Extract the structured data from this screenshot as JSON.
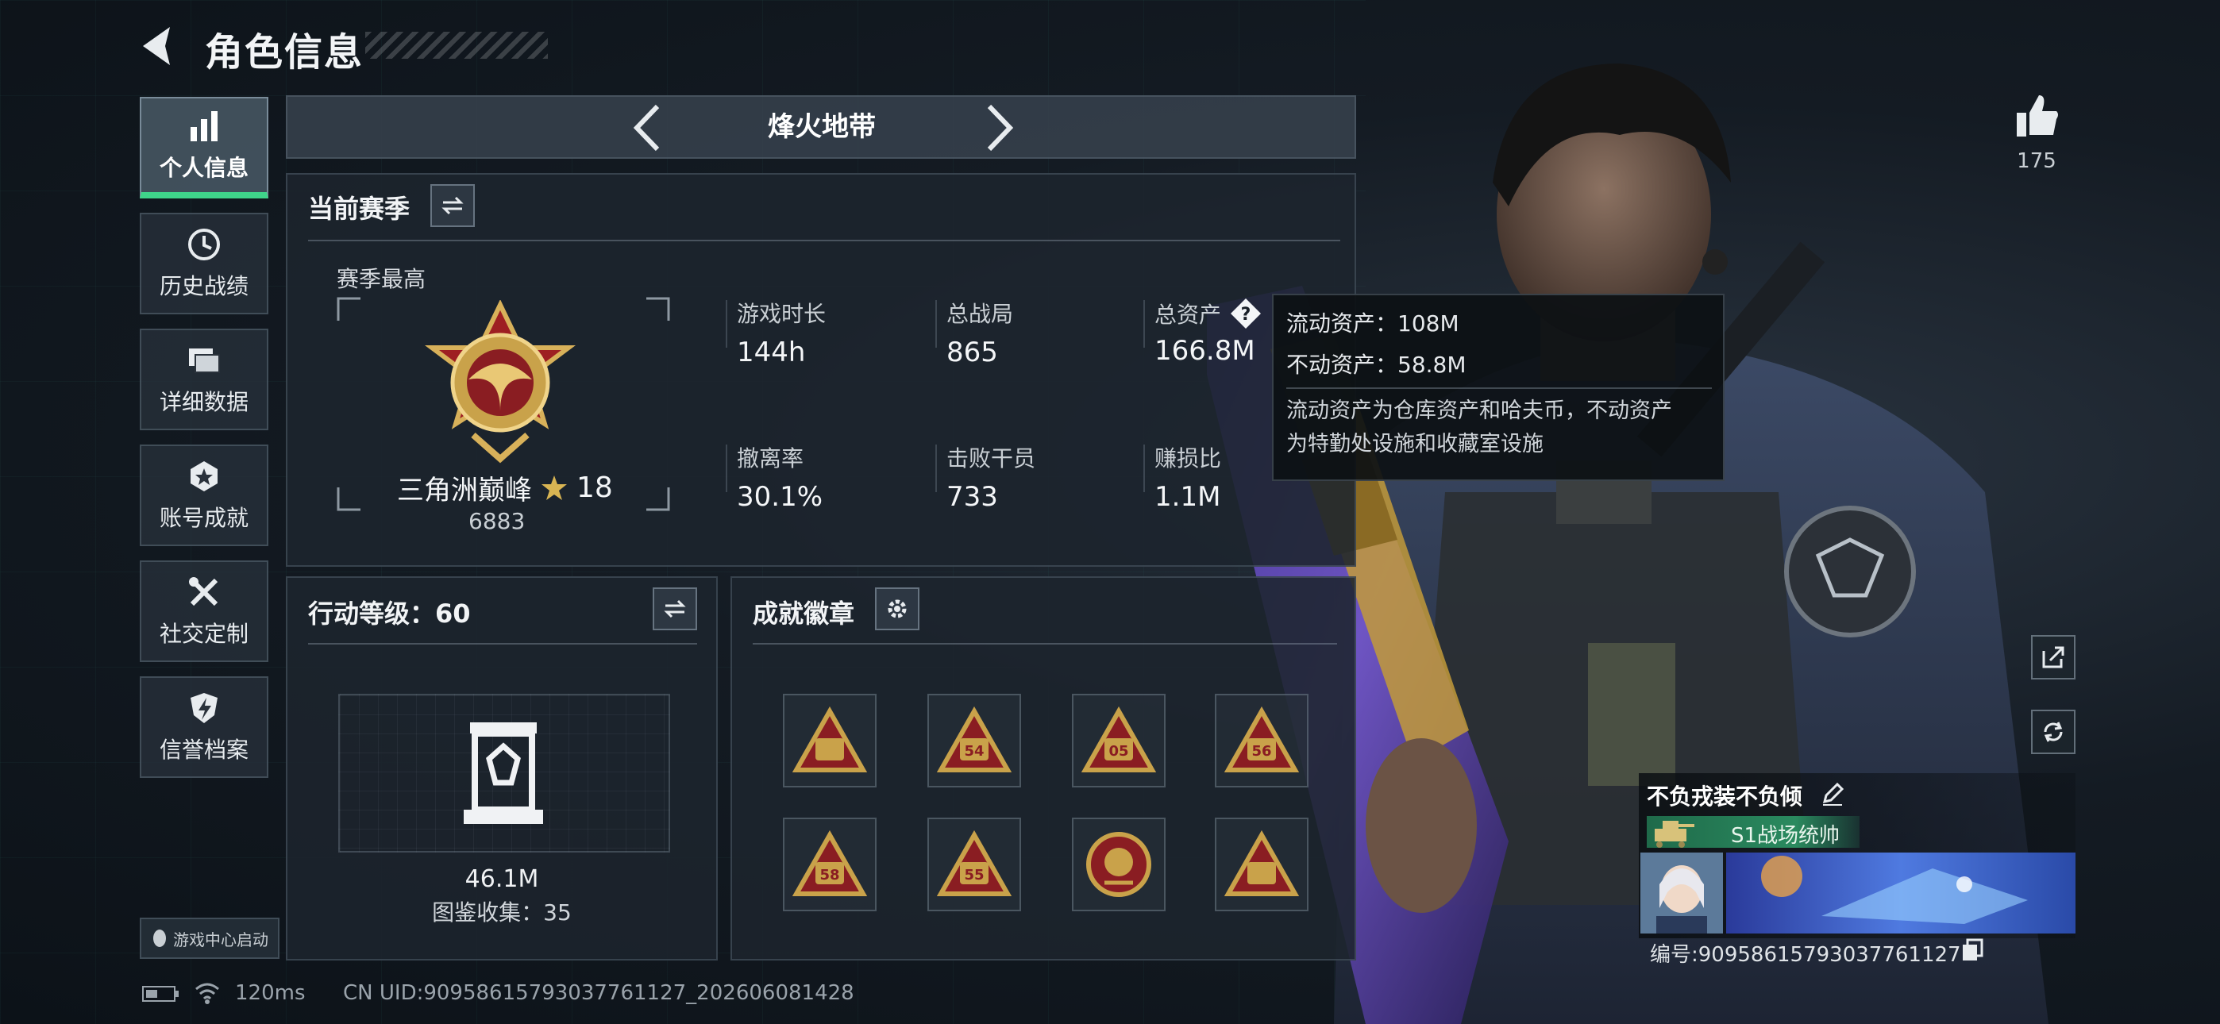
{
  "header": {
    "title": "角色信息"
  },
  "sidebar": {
    "items": [
      {
        "label": "个人信息",
        "icon": "bar-chart-icon",
        "active": true
      },
      {
        "label": "历史战绩",
        "icon": "history-clock-icon"
      },
      {
        "label": "详细数据",
        "icon": "folder-stack-icon"
      },
      {
        "label": "账号成就",
        "icon": "medal-star-icon"
      },
      {
        "label": "社交定制",
        "icon": "tools-cross-icon"
      },
      {
        "label": "信誉档案",
        "icon": "shield-bolt-icon"
      }
    ],
    "launch_label": "游戏中心启动"
  },
  "mode": {
    "label": "烽火地带"
  },
  "season": {
    "title": "当前赛季",
    "peak_label": "赛季最高",
    "rank_name": "三角洲巅峰",
    "rank_stars": "18",
    "rank_score": "6883",
    "stats": [
      {
        "label": "游戏时长",
        "value": "144h"
      },
      {
        "label": "总战局",
        "value": "865"
      },
      {
        "label": "总资产",
        "value": "166.8M",
        "has_help": true
      },
      {
        "label": "撤离率",
        "value": "30.1%"
      },
      {
        "label": "击败干员",
        "value": "733"
      },
      {
        "label": "赚损比",
        "value": "1.1M"
      }
    ]
  },
  "action_level": {
    "title": "行动等级：60",
    "value": "46.1M",
    "collection": "图鉴收集：35"
  },
  "achievements": {
    "title": "成就徽章",
    "badges": [
      {
        "icon": "triangle-emblem-icon",
        "mark": ""
      },
      {
        "icon": "triangle-emblem-icon",
        "mark": "54"
      },
      {
        "icon": "triangle-emblem-icon",
        "mark": "05"
      },
      {
        "icon": "triangle-emblem-icon",
        "mark": "56"
      },
      {
        "icon": "triangle-emblem-icon",
        "mark": "58"
      },
      {
        "icon": "triangle-emblem-icon",
        "mark": "55"
      },
      {
        "icon": "round-crest-icon",
        "mark": ""
      },
      {
        "icon": "triangle-emblem-icon",
        "mark": ""
      }
    ]
  },
  "tooltip": {
    "liquid": "流动资产：108M",
    "fixed": "不动资产：58.8M",
    "desc_line1": "流动资产为仓库资产和哈夫币，不动资产",
    "desc_line2": "为特勤处设施和收藏室设施"
  },
  "likes": {
    "count": "175"
  },
  "card": {
    "name": "不负戎装不负倾",
    "title": "S1战场统帅",
    "id": "编号:9095861579303776112​7"
  },
  "footer": {
    "ping": "120ms",
    "uid": "CN UID:90958615793037761127_202606081428"
  },
  "colors": {
    "accent": "#3fd48a",
    "gold": "#c9a24a",
    "panel": "#1c242d",
    "badge_red": "#8a1d22"
  }
}
